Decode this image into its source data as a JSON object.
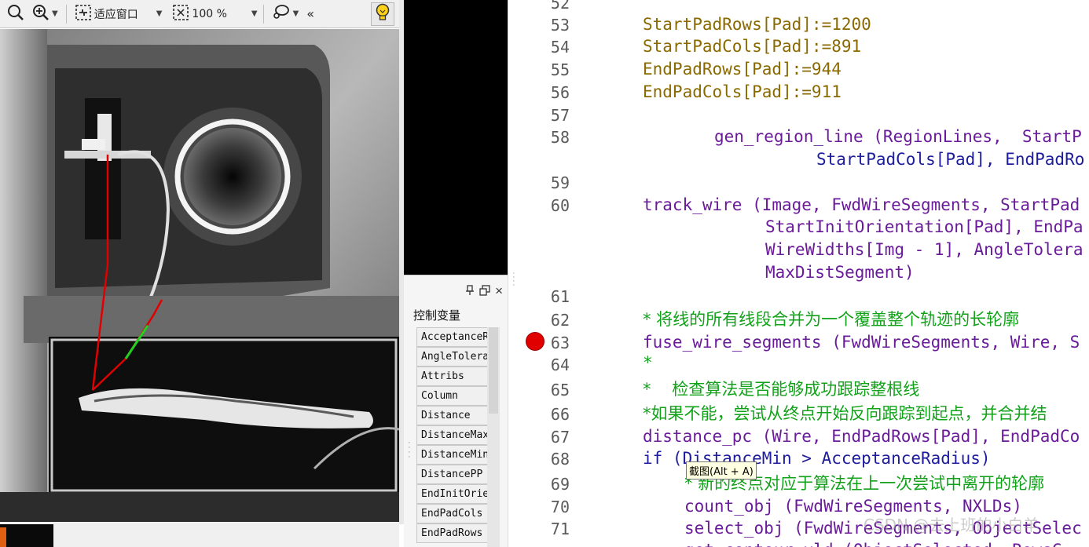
{
  "toolbar": {
    "fit_window_label": "适应窗口",
    "zoom_label": "100 %",
    "collapse_label": "«"
  },
  "variable_panel": {
    "title": "控制变量",
    "pin_icon": "pin-icon",
    "float_icon": "float-icon",
    "close_icon": "×",
    "items": [
      "AcceptanceRadius",
      "AngleTolerance",
      "Attribs",
      "Column",
      "Distance",
      "DistanceMax",
      "DistanceMin",
      "DistancePP",
      "EndInitOrientation",
      "EndPadCols",
      "EndPadRows"
    ]
  },
  "editor": {
    "lines": [
      {
        "num": "52",
        "text": ""
      },
      {
        "num": "53",
        "text": "StartPadRows[Pad]:=1200"
      },
      {
        "num": "54",
        "text": "StartPadCols[Pad]:=891"
      },
      {
        "num": "55",
        "text": "EndPadRows[Pad]:=944"
      },
      {
        "num": "56",
        "text": "EndPadCols[Pad]:=911"
      },
      {
        "num": "57",
        "text": ""
      },
      {
        "num": "58",
        "text": "gen_region_line (RegionLines,  StartP"
      },
      {
        "num": "",
        "text": "StartPadCols[Pad], EndPadRo"
      },
      {
        "num": "59",
        "text": ""
      },
      {
        "num": "60",
        "text": "track_wire (Image, FwdWireSegments, StartPad"
      },
      {
        "num": "",
        "text": "StartInitOrientation[Pad], EndPa"
      },
      {
        "num": "",
        "text": "WireWidths[Img - 1], AngleTolera"
      },
      {
        "num": "",
        "text": "MaxDistSegment)"
      },
      {
        "num": "61",
        "text": ""
      },
      {
        "num": "62",
        "text": "* 将线的所有线段合并为一个覆盖整个轨迹的长轮廓"
      },
      {
        "num": "63",
        "text": "fuse_wire_segments (FwdWireSegments, Wire, S"
      },
      {
        "num": "64",
        "text": "*"
      },
      {
        "num": "65",
        "text": "*    检查算法是否能够成功跟踪整根线"
      },
      {
        "num": "66",
        "text": "*如果不能，尝试从终点开始反向跟踪到起点，并合并结"
      },
      {
        "num": "67",
        "text": "distance_pc (Wire, EndPadRows[Pad], EndPadCo"
      },
      {
        "num": "68",
        "text": "if (DistanceMin > AcceptanceRadius)"
      },
      {
        "num": "69",
        "text": "* 新的终点对应于算法在上一次尝试中离开的轮廓"
      },
      {
        "num": "70",
        "text": "count_obj (FwdWireSegments, NXLDs)"
      },
      {
        "num": "71",
        "text": "select_obj (FwdWireSegments, ObjectSelec"
      },
      {
        "num": "72",
        "text": "get_contour_xld (ObjectSelected, RowsC"
      }
    ],
    "tooltip": "截图(Alt + A)",
    "watermark": "CSDN @去上班的小白羊"
  }
}
